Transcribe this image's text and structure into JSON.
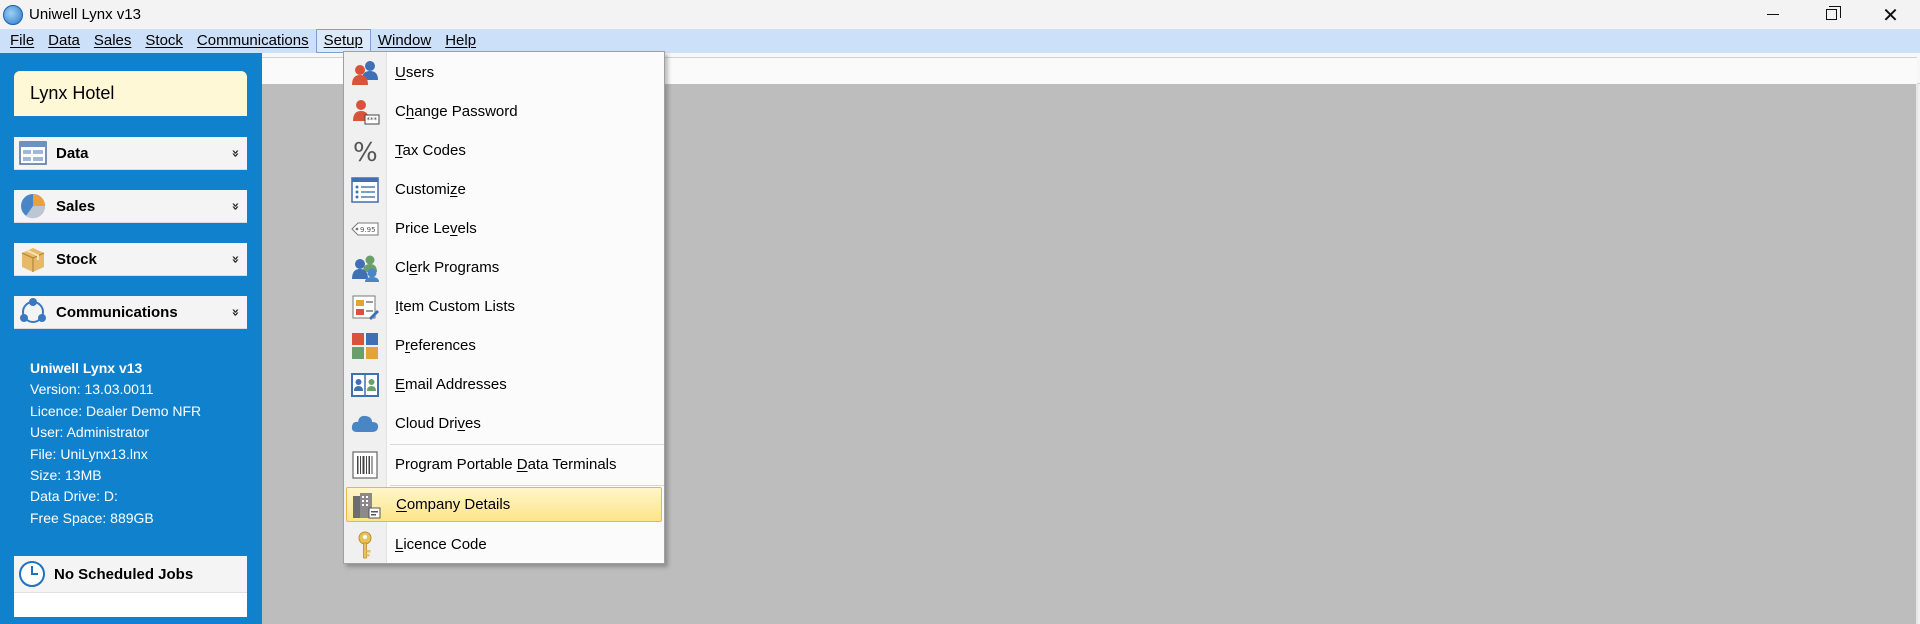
{
  "window": {
    "title": "Uniwell Lynx v13",
    "minimize": "—",
    "restore": "",
    "close": "✕"
  },
  "menubar": {
    "items": [
      {
        "label": "File"
      },
      {
        "label": "Data"
      },
      {
        "label": "Sales"
      },
      {
        "label": "Stock"
      },
      {
        "label": "Communications"
      },
      {
        "label": "Setup"
      },
      {
        "label": "Window"
      },
      {
        "label": "Help"
      }
    ]
  },
  "leftpanel": {
    "hotel": "Lynx Hotel",
    "sections": [
      {
        "label": "Data",
        "chevron": "»"
      },
      {
        "label": "Sales",
        "chevron": "»"
      },
      {
        "label": "Stock",
        "chevron": "»"
      },
      {
        "label": "Communications",
        "chevron": "»"
      }
    ],
    "info": {
      "app": "Uniwell Lynx v13",
      "version": "Version: 13.03.0011",
      "licence": "Licence: Dealer Demo NFR",
      "user": "User: Administrator",
      "file": "File: UniLynx13.lnx",
      "size": "Size: 13MB",
      "drive": "Data Drive: D:",
      "free": "Free Space: 889GB"
    },
    "jobs": "No Scheduled Jobs"
  },
  "setup_menu": {
    "items": [
      {
        "pre": "",
        "ul": "U",
        "post": "sers",
        "icon": "users-icon"
      },
      {
        "pre": "C",
        "ul": "h",
        "post": "ange Password",
        "icon": "change-password-icon"
      },
      {
        "pre": "",
        "ul": "T",
        "post": "ax Codes",
        "icon": "percent-icon"
      },
      {
        "pre": "Customi",
        "ul": "z",
        "post": "e",
        "icon": "customize-icon"
      },
      {
        "pre": "Price Le",
        "ul": "v",
        "post": "els",
        "icon": "price-tag-icon"
      },
      {
        "pre": "Cl",
        "ul": "e",
        "post": "rk Programs",
        "icon": "clerk-programs-icon"
      },
      {
        "pre": "",
        "ul": "I",
        "post": "tem Custom Lists",
        "icon": "item-custom-lists-icon"
      },
      {
        "pre": "P",
        "ul": "r",
        "post": "eferences",
        "icon": "preferences-icon"
      },
      {
        "pre": "",
        "ul": "E",
        "post": "mail Addresses",
        "icon": "email-addresses-icon"
      },
      {
        "pre": "Cloud Dri",
        "ul": "v",
        "post": "es",
        "icon": "cloud-icon"
      },
      {
        "pre": "Program Portable ",
        "ul": "D",
        "post": "ata Terminals",
        "icon": "barcode-icon"
      },
      {
        "pre": "",
        "ul": "C",
        "post": "ompany Details",
        "icon": "company-details-icon"
      },
      {
        "pre": "",
        "ul": "L",
        "post": "icence Code",
        "icon": "key-icon"
      }
    ],
    "selected_index": 11
  },
  "colors": {
    "panel_blue": "#1082cd",
    "menubar": "#cce0fa",
    "highlight": "#fde58a"
  }
}
